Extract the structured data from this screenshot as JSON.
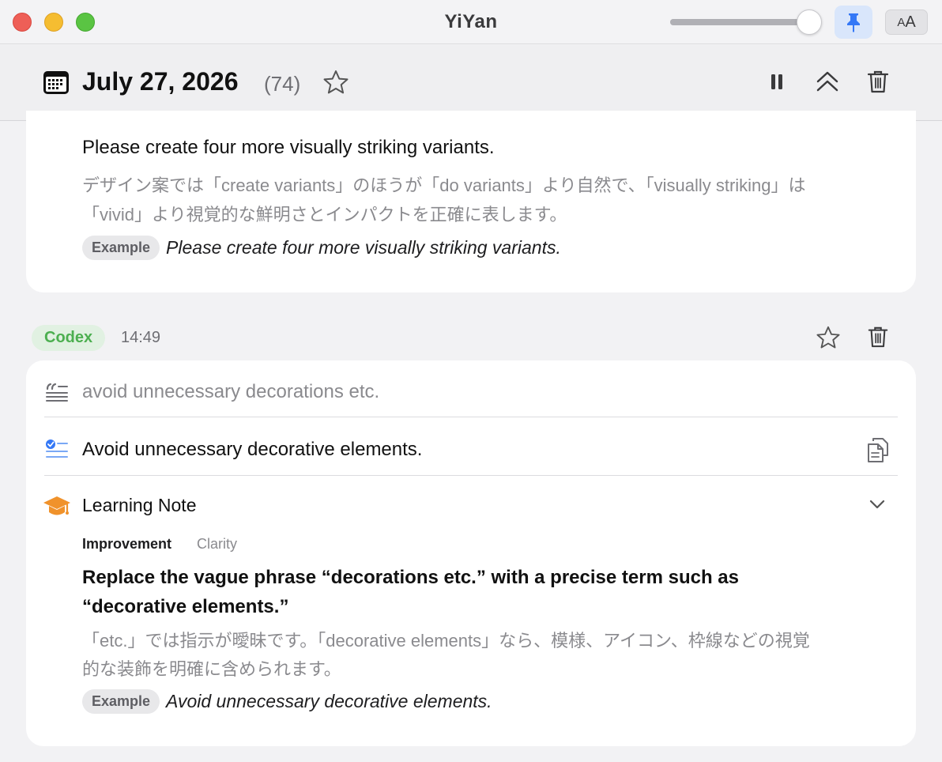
{
  "window": {
    "title": "YiYan",
    "slider_value": 0.92,
    "colors": {
      "pin_active_bg": "#d9e6fb",
      "pin_icon": "#3478f6",
      "codex_green": "#4caf50"
    }
  },
  "toolbar": {
    "font_button_big": "A",
    "font_button_small": "A"
  },
  "header": {
    "date": "July 27, 2026",
    "count": "(74)"
  },
  "entry_prev": {
    "sentence": "Please create four more visually striking variants.",
    "explanation_line1": "デザイン案では「create variants」のほうが「do variants」より自然で、「visually striking」は",
    "explanation_line2": "「vivid」より視覚的な鮮明さとインパクトを正確に表します。",
    "example_label": "Example",
    "example_text": "Please create four more visually striking variants."
  },
  "entry": {
    "source_badge": "Codex",
    "time": "14:49",
    "original": "avoid unnecessary decorations etc.",
    "translation": "Avoid unnecessary decorative elements.",
    "note_title": "Learning Note",
    "note_category": "Improvement",
    "note_subcategory": "Clarity",
    "advice_line1": "Replace the vague phrase “decorations etc.” with a precise term such as",
    "advice_line2": "“decorative elements.”",
    "explanation_line1": "「etc.」では指示が曖昧です。「decorative elements」なら、模様、アイコン、枠線などの視覚",
    "explanation_line2": "的な装飾を明確に含められます。",
    "example_label": "Example",
    "example_text": "Avoid unnecessary decorative elements."
  }
}
